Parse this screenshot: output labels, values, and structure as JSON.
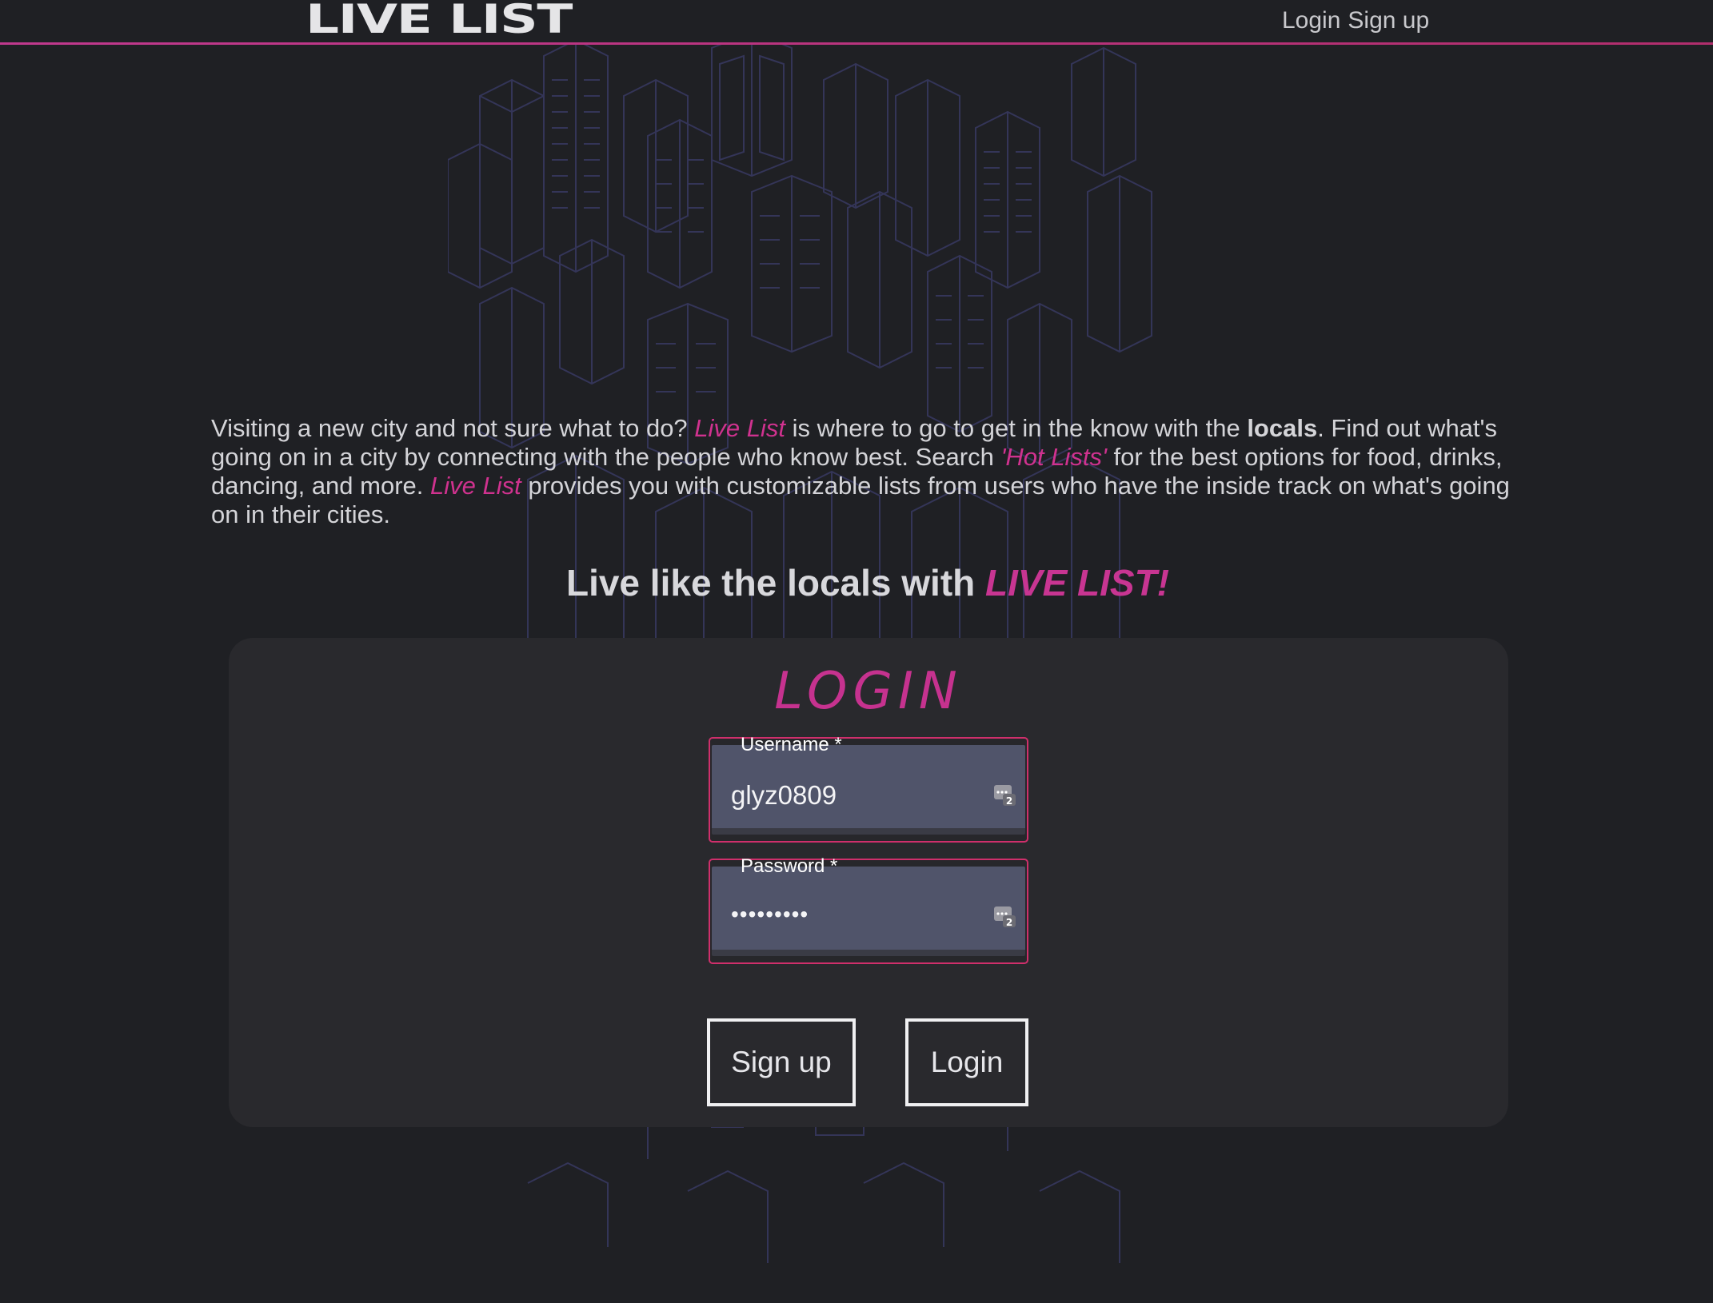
{
  "header": {
    "logo": "LIVE LIST",
    "nav": [
      {
        "label": "Login"
      },
      {
        "label": "Sign up"
      }
    ]
  },
  "intro": {
    "p1": "Visiting a new city and not sure what to do? ",
    "brand1": "Live List",
    "p2": " is where to go to get in the know with the ",
    "locals": "locals",
    "p3": ". Find out what's going on in a city by connecting with the people who know best. Search ",
    "hotlists": "'Hot Lists'",
    "p4": " for the best options for food, drinks, dancing, and more. ",
    "brand2": "Live List",
    "p5": " provides you with customizable lists from users who have the inside track on what's going on in their cities."
  },
  "tagline": {
    "text": "Live like the locals with ",
    "brand": "LIVE LIST!"
  },
  "login": {
    "title": "LOGIN",
    "username": {
      "label": "Username *",
      "value": "glyz0809"
    },
    "password": {
      "label": "Password *",
      "value": "•••••••••"
    },
    "keychain_badge": "2",
    "signup_button": "Sign up",
    "login_button": "Login"
  },
  "colors": {
    "accent": "#c6328f",
    "background": "#1f2024",
    "card": "#29292d",
    "input": "#50546a"
  }
}
